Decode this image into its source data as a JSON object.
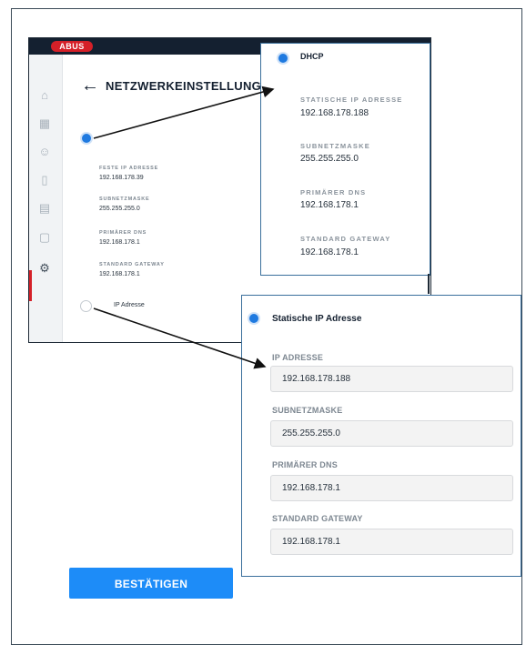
{
  "app": {
    "logo": "ABUS",
    "title": "NETZWERKEINSTELLUNG",
    "sidebar_icons": [
      "home-icon",
      "floor-plan-icon",
      "user-icon",
      "door-icon",
      "calendar-icon",
      "tablet-icon",
      "settings-icon"
    ],
    "fields": [
      {
        "label": "FESTE IP ADRESSE",
        "value": "192.168.178.39"
      },
      {
        "label": "SUBNETZMASKE",
        "value": "255.255.255.0"
      },
      {
        "label": "PRIMÄRER DNS",
        "value": "192.168.178.1"
      },
      {
        "label": "STANDARD GATEWAY",
        "value": "192.168.178.1"
      }
    ],
    "second_radio_label": "IP Adresse"
  },
  "dhcp": {
    "title": "DHCP",
    "fields": [
      {
        "label": "STATISCHE IP ADRESSE",
        "value": "192.168.178.188"
      },
      {
        "label": "SUBNETZMASKE",
        "value": "255.255.255.0"
      },
      {
        "label": "PRIMÄRER DNS",
        "value": "192.168.178.1"
      },
      {
        "label": "STANDARD GATEWAY",
        "value": "192.168.178.1"
      }
    ]
  },
  "static": {
    "title": "Statische IP Adresse",
    "fields": [
      {
        "label": "IP ADRESSE",
        "value": "192.168.178.188"
      },
      {
        "label": "SUBNETZMASKE",
        "value": "255.255.255.0"
      },
      {
        "label": "PRIMÄRER DNS",
        "value": "192.168.178.1"
      },
      {
        "label": "STANDARD GATEWAY",
        "value": "192.168.178.1"
      }
    ]
  },
  "confirm_label": "BESTÄTIGEN",
  "colors": {
    "accent": "#1d8cf8",
    "brand": "#d52028",
    "topbar": "#142030",
    "callout_border": "#3a6f9c"
  }
}
